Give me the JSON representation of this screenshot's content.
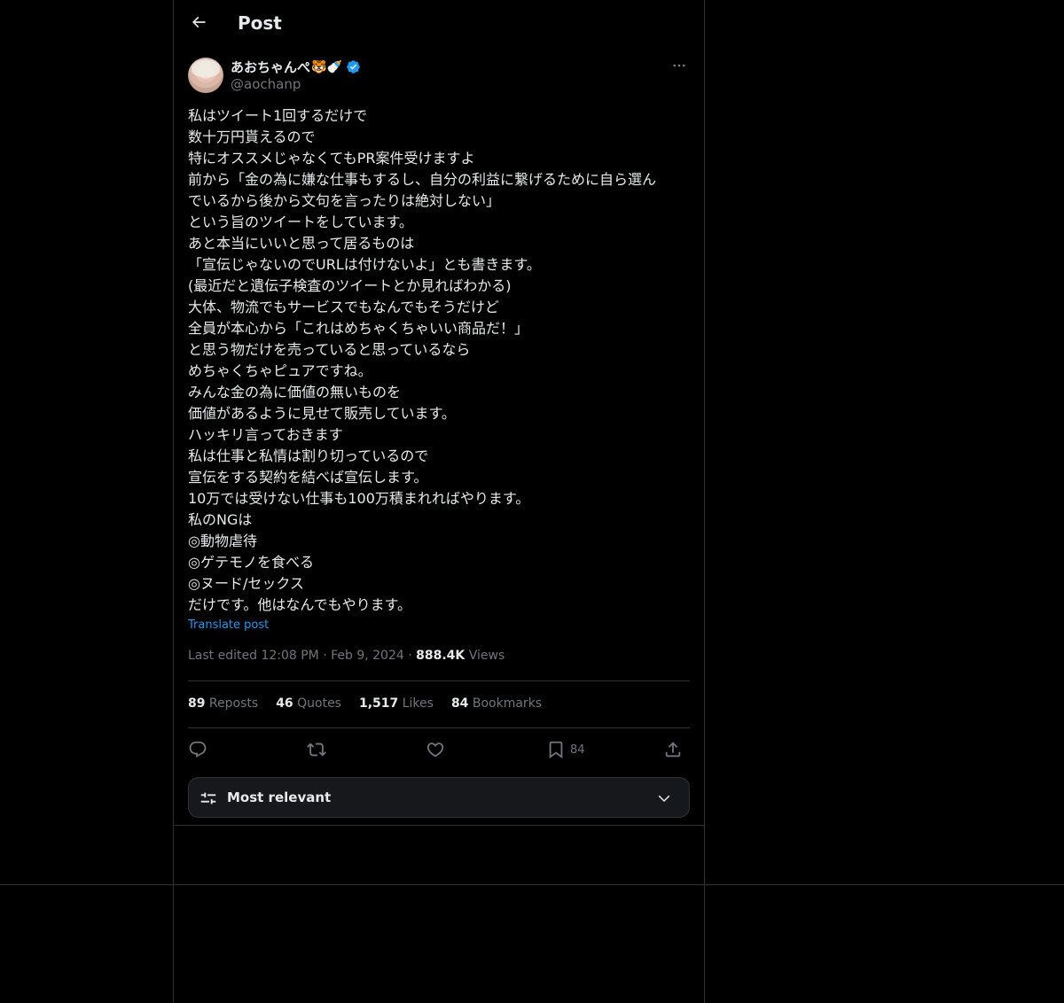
{
  "header": {
    "title": "Post",
    "back_icon": "arrow-left-icon"
  },
  "author": {
    "display_name": "あおちゃんぺ",
    "emoji": "🐯🍼",
    "verified": true,
    "handle": "@aochanp"
  },
  "post": {
    "text": "私はツイート1回するだけで\n数十万円貰えるので\n特にオススメじゃなくてもPR案件受けますよ\n前から「金の為に嫌な仕事もするし、自分の利益に繋げるために自ら選ん\nでいるから後から文句を言ったりは絶対しない」\nという旨のツイートをしています。\nあと本当にいいと思って居るものは\n「宣伝じゃないのでURLは付けないよ」とも書きます。\n(最近だと遺伝子検査のツイートとか見ればわかる)\n大体、物流でもサービスでもなんでもそうだけど\n全員が本心から「これはめちゃくちゃいい商品だ！」\nと思う物だけを売っていると思っているなら\nめちゃくちゃピュアですね。\nみんな金の為に価値の無いものを\n価値があるように見せて販売しています。\nハッキリ言っておきます\n私は仕事と私情は割り切っているので\n宣伝をする契約を結べば宣伝します。\n10万では受けない仕事も100万積まれればやります。\n私のNGは\n◎動物虐待\n◎ゲテモノを食べる\n◎ヌード/セックス\nだけです。他はなんでもやります。",
    "translate_label": "Translate post",
    "meta_prefix": "Last edited 12:08 PM · Feb 9, 2024 · ",
    "views_count": "888.4K",
    "views_label": " Views"
  },
  "stats": [
    {
      "count": "89",
      "label": " Reposts"
    },
    {
      "count": "46",
      "label": " Quotes"
    },
    {
      "count": "1,517",
      "label": " Likes"
    },
    {
      "count": "84",
      "label": " Bookmarks"
    }
  ],
  "actions": {
    "bookmark_count": "84"
  },
  "sort": {
    "label": "Most relevant"
  },
  "colors": {
    "accent": "#1d9bf0",
    "background": "#000000",
    "border": "#2f3336",
    "muted": "#71767b"
  }
}
